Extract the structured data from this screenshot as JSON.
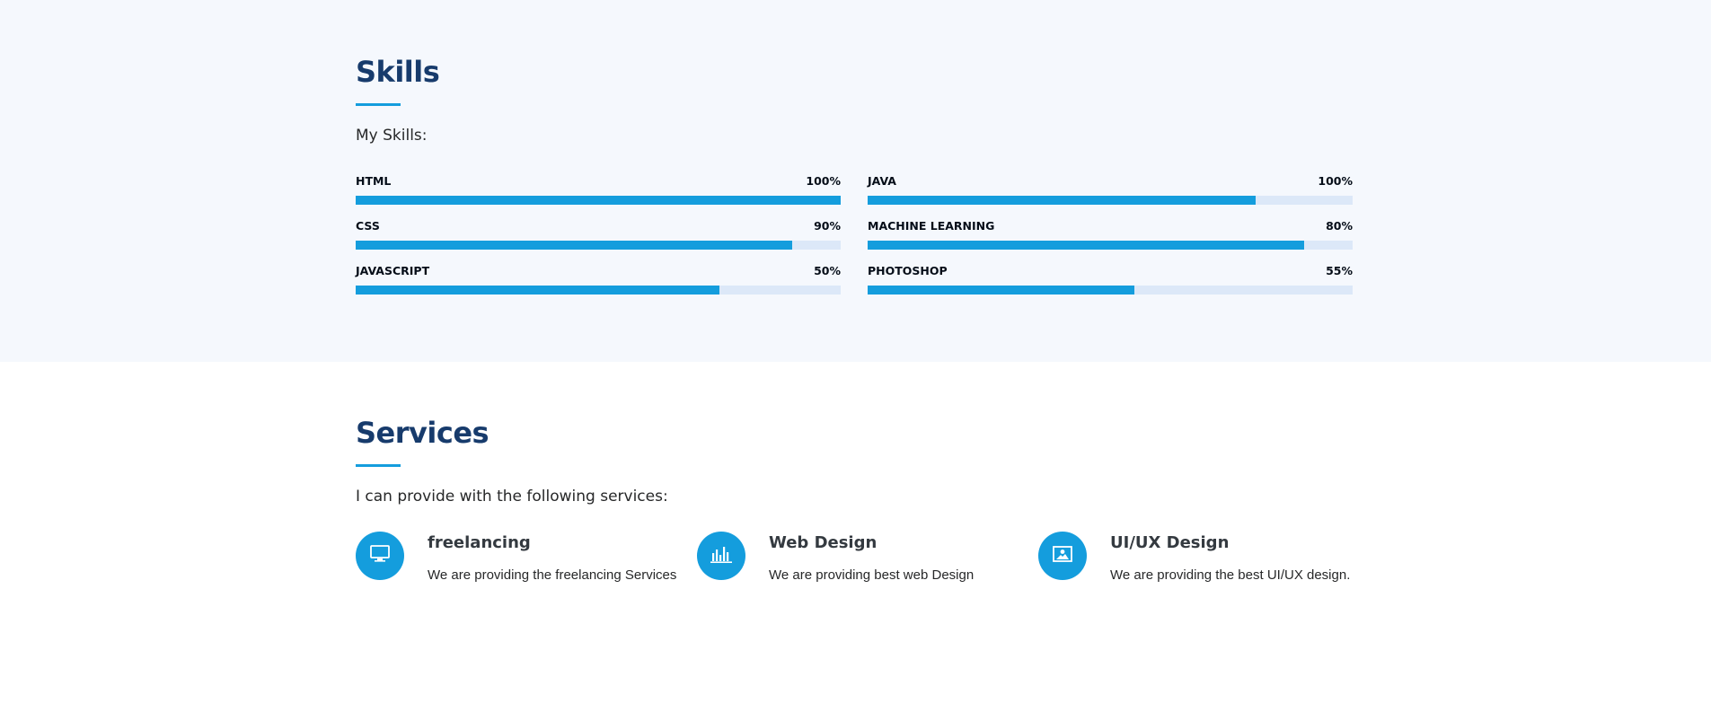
{
  "skills": {
    "title": "Skills",
    "description": "My Skills:",
    "items": [
      {
        "name": "HTML",
        "value_label": "100%",
        "fill_fraction": 1.0
      },
      {
        "name": "JAVA",
        "value_label": "100%",
        "fill_fraction": 0.8
      },
      {
        "name": "CSS",
        "value_label": "90%",
        "fill_fraction": 0.9
      },
      {
        "name": "MACHINE LEARNING",
        "value_label": "80%",
        "fill_fraction": 0.9
      },
      {
        "name": "JAVASCRIPT",
        "value_label": "50%",
        "fill_fraction": 0.75
      },
      {
        "name": "PHOTOSHOP",
        "value_label": "55%",
        "fill_fraction": 0.55
      }
    ]
  },
  "services": {
    "title": "Services",
    "description": "I can provide with the following services:",
    "items": [
      {
        "title": "freelancing",
        "description": "We are providing the freelancing Services",
        "icon": "monitor-icon"
      },
      {
        "title": "Web Design",
        "description": "We are providing best web Design",
        "icon": "bar-chart-icon"
      },
      {
        "title": "UI/UX Design",
        "description": "We are providing the best UI/UX design.",
        "icon": "image-icon"
      }
    ]
  },
  "colors": {
    "accent": "#149ddd",
    "heading": "#173b6c",
    "track": "#dce8f8",
    "skills_bg": "#f5f8fd"
  }
}
